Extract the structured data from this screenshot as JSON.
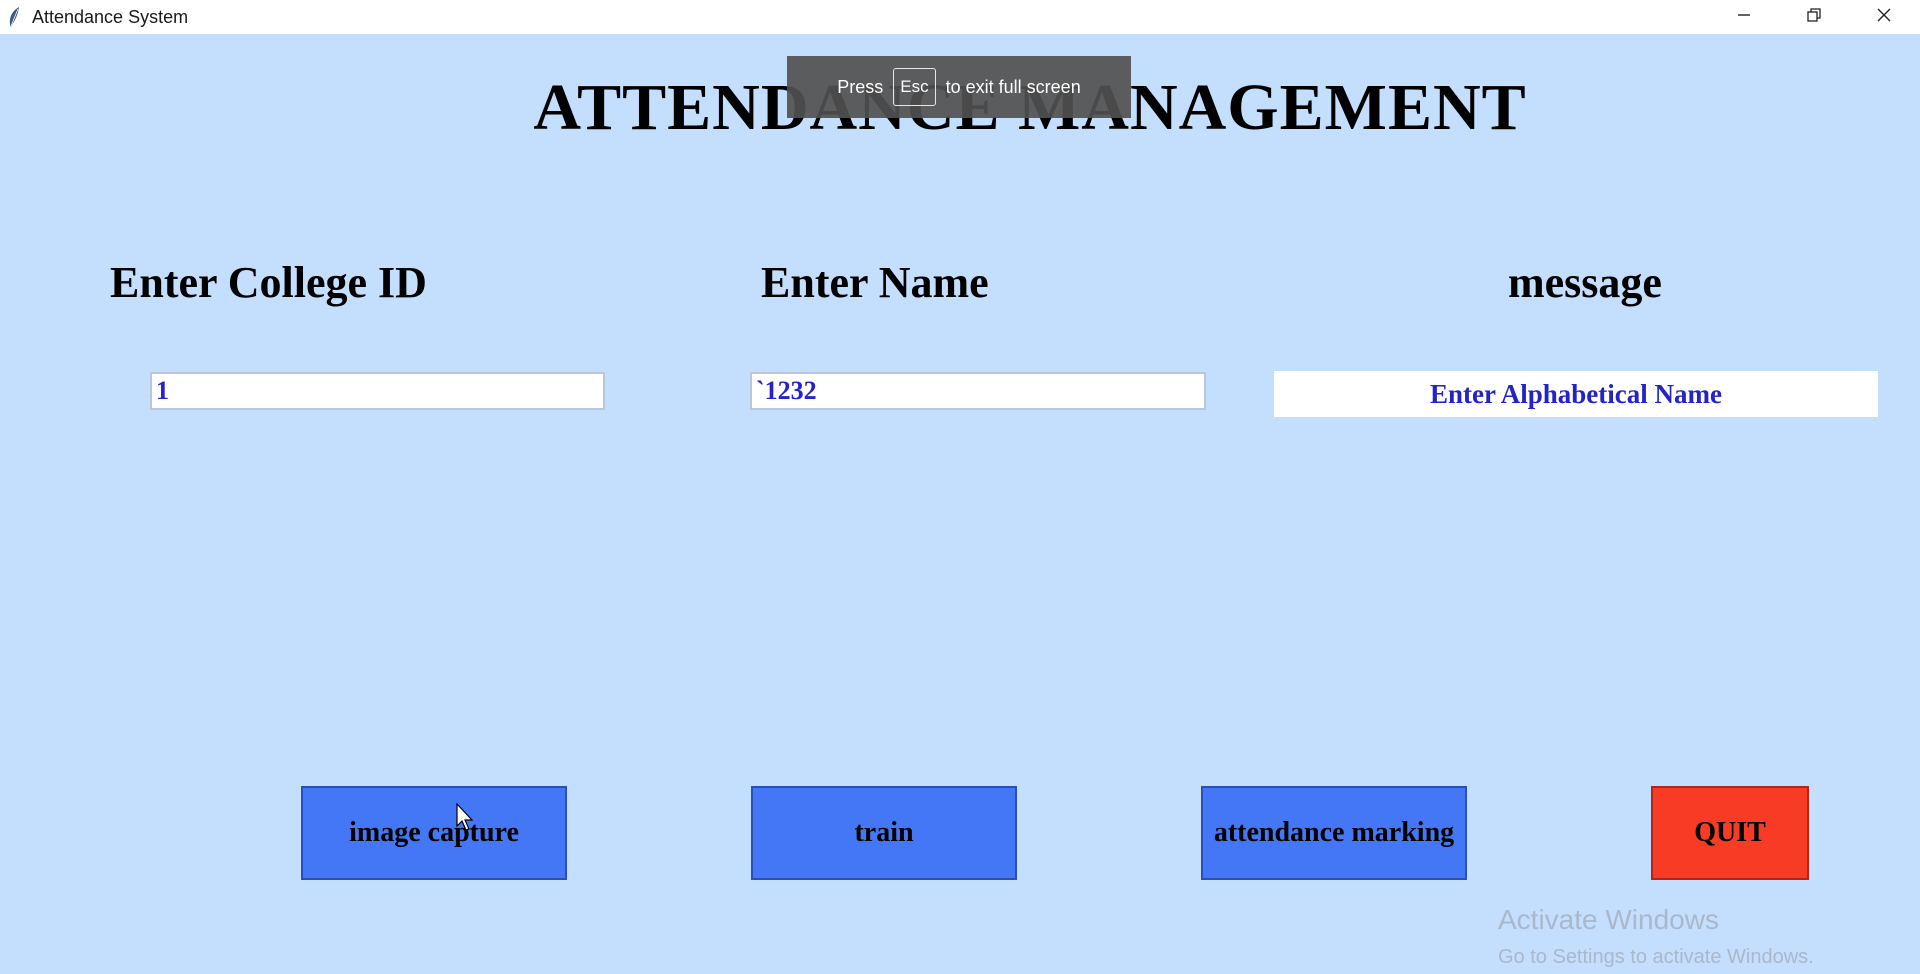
{
  "window": {
    "title": "Attendance System",
    "icon": "feather-icon",
    "controls": [
      "minimize-icon",
      "restore-icon",
      "close-icon"
    ]
  },
  "fullscreen_notice": {
    "before": "Press",
    "key": "Esc",
    "after": "to exit full screen"
  },
  "heading": "ATTENDANCE MANAGEMENT",
  "labels": {
    "college_id": "Enter College ID",
    "name": "Enter Name",
    "message": "message"
  },
  "inputs": {
    "college_id_value": "1",
    "name_value": "`1232"
  },
  "message_text": "Enter Alphabetical Name",
  "buttons": {
    "image_capture": "image capture",
    "train": "train",
    "attendance_marking": "attendance marking",
    "quit": "QUIT"
  },
  "watermark": {
    "line1": "Activate Windows",
    "line2": "Go to Settings to activate Windows."
  },
  "colors": {
    "background": "#c4defd",
    "button": "#4477f5",
    "quit_button": "#f83b24",
    "field_text": "#2323c8"
  }
}
